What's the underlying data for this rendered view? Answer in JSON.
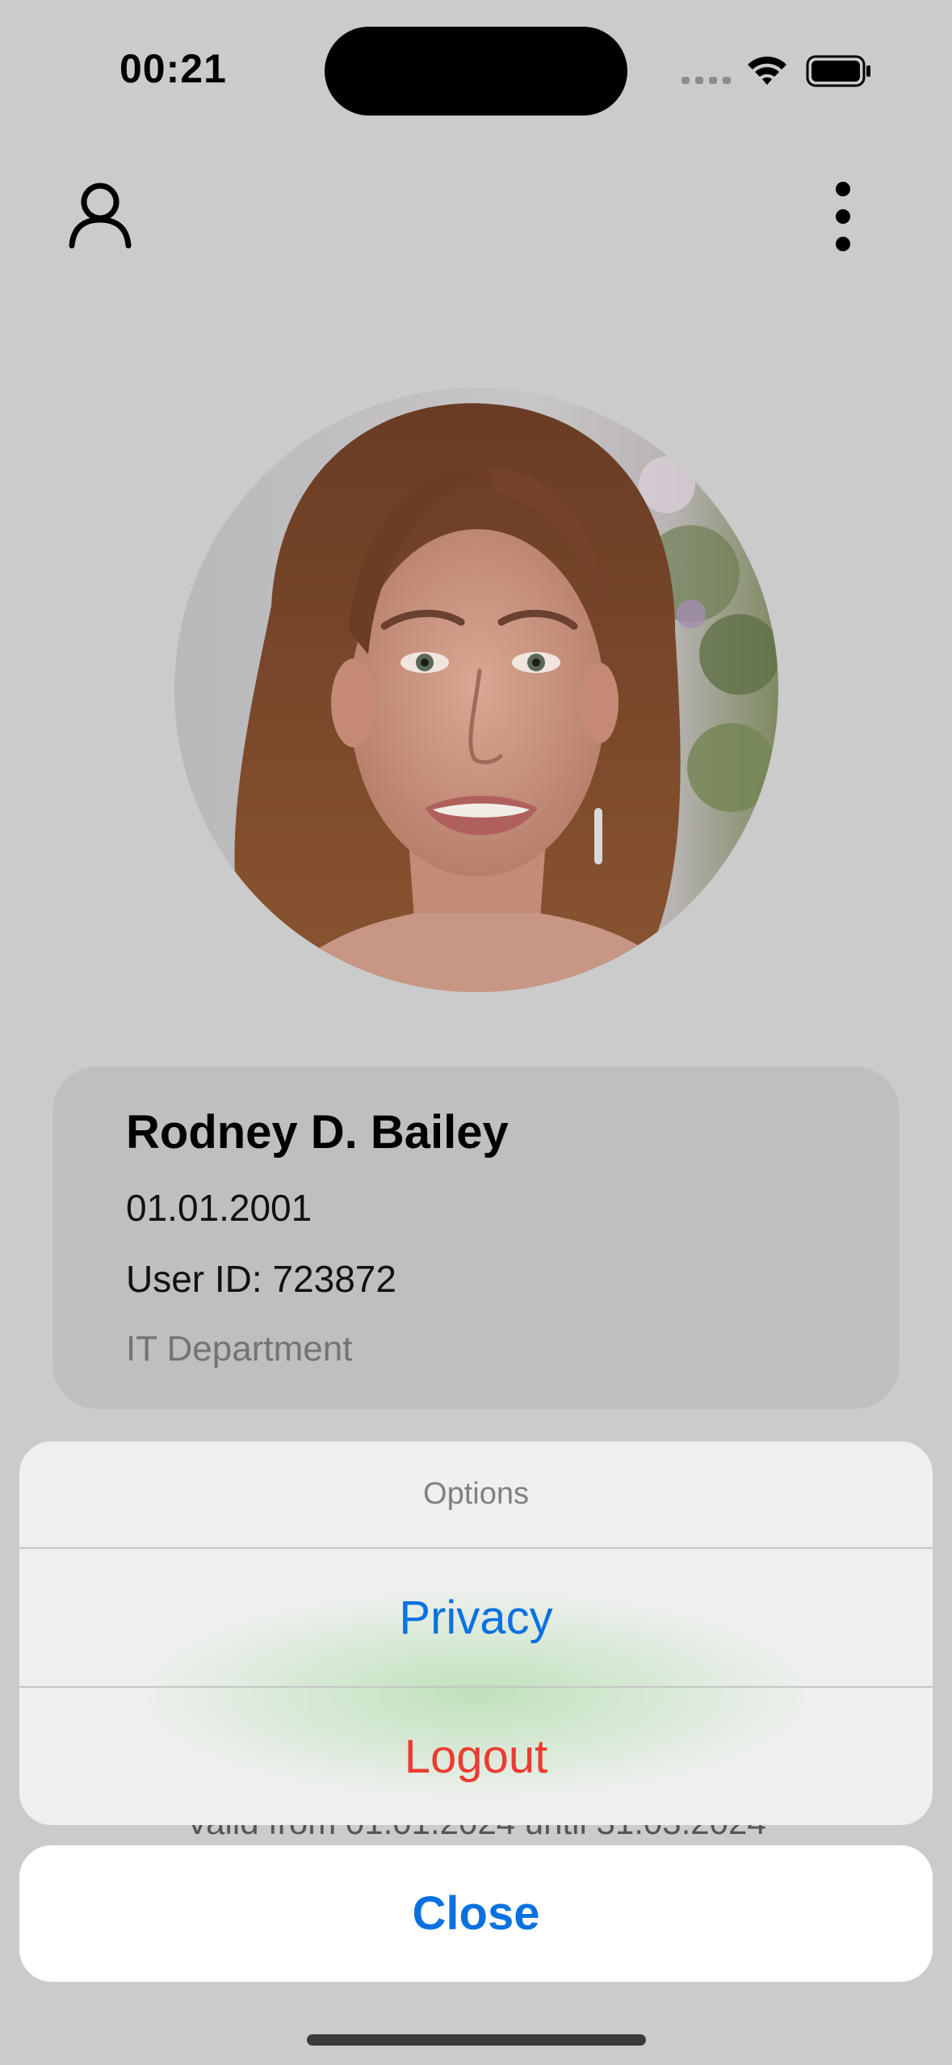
{
  "status_bar": {
    "time": "00:21",
    "icons": [
      "cellular-signal-icon",
      "wifi-icon",
      "battery-icon"
    ]
  },
  "nav": {
    "left_icon": "person-icon",
    "right_icon": "more-vertical-icon"
  },
  "profile": {
    "name": "Rodney D. Bailey",
    "birth_date": "01.01.2001",
    "user_id": "User ID: 723872",
    "department": "IT Department"
  },
  "card_validity_partial": "Valid from 01.01.2024 until 31.03.2024",
  "action_sheet": {
    "title": "Options",
    "actions": [
      {
        "label": "Privacy",
        "color": "#0a72e0"
      },
      {
        "label": "Logout",
        "color": "#ec3b30"
      }
    ],
    "cancel_label": "Close"
  },
  "colors": {
    "accent": "#0a72e0",
    "destructive": "#ec3b30",
    "dimmed_background": "#cbcbcb"
  }
}
